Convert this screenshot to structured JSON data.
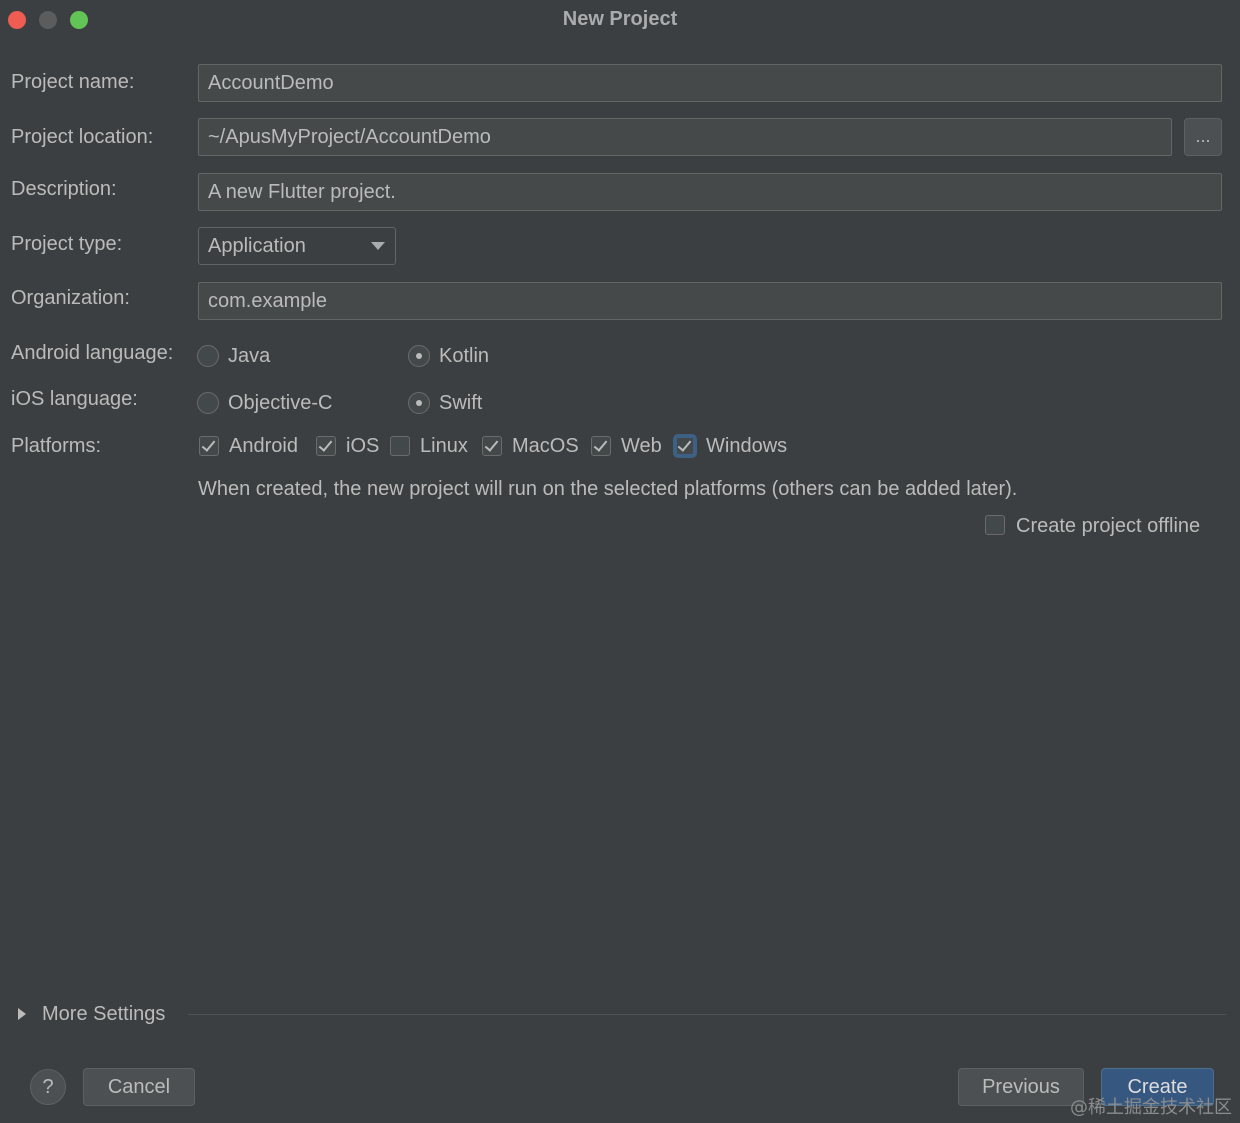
{
  "window": {
    "title": "New Project"
  },
  "form": {
    "project_name": {
      "label": "Project name:",
      "value": "AccountDemo"
    },
    "project_location": {
      "label": "Project location:",
      "value": "~/ApusMyProject/AccountDemo",
      "browse_label": "..."
    },
    "description": {
      "label": "Description:",
      "value": "A new Flutter project."
    },
    "project_type": {
      "label": "Project type:",
      "value": "Application"
    },
    "organization": {
      "label": "Organization:",
      "value": "com.example"
    },
    "android_language": {
      "label": "Android language:",
      "options": [
        {
          "label": "Java",
          "selected": false
        },
        {
          "label": "Kotlin",
          "selected": true
        }
      ]
    },
    "ios_language": {
      "label": "iOS language:",
      "options": [
        {
          "label": "Objective-C",
          "selected": false
        },
        {
          "label": "Swift",
          "selected": true
        }
      ]
    },
    "platforms": {
      "label": "Platforms:",
      "items": [
        {
          "label": "Android",
          "checked": true
        },
        {
          "label": "iOS",
          "checked": true
        },
        {
          "label": "Linux",
          "checked": false
        },
        {
          "label": "MacOS",
          "checked": true
        },
        {
          "label": "Web",
          "checked": true
        },
        {
          "label": "Windows",
          "checked": true
        }
      ],
      "hint": "When created, the new project will run on the selected platforms (others can be added later)."
    },
    "offline": {
      "label": "Create project offline",
      "checked": false
    }
  },
  "more_settings": {
    "label": "More Settings"
  },
  "footer": {
    "help_label": "?",
    "cancel_label": "Cancel",
    "previous_label": "Previous",
    "create_label": "Create"
  },
  "watermark": "@稀土掘金技术社区",
  "colors": {
    "background": "#3c3f41",
    "field": "#45494a",
    "primary_button": "#365880",
    "focus_ring": "#3d6185"
  }
}
